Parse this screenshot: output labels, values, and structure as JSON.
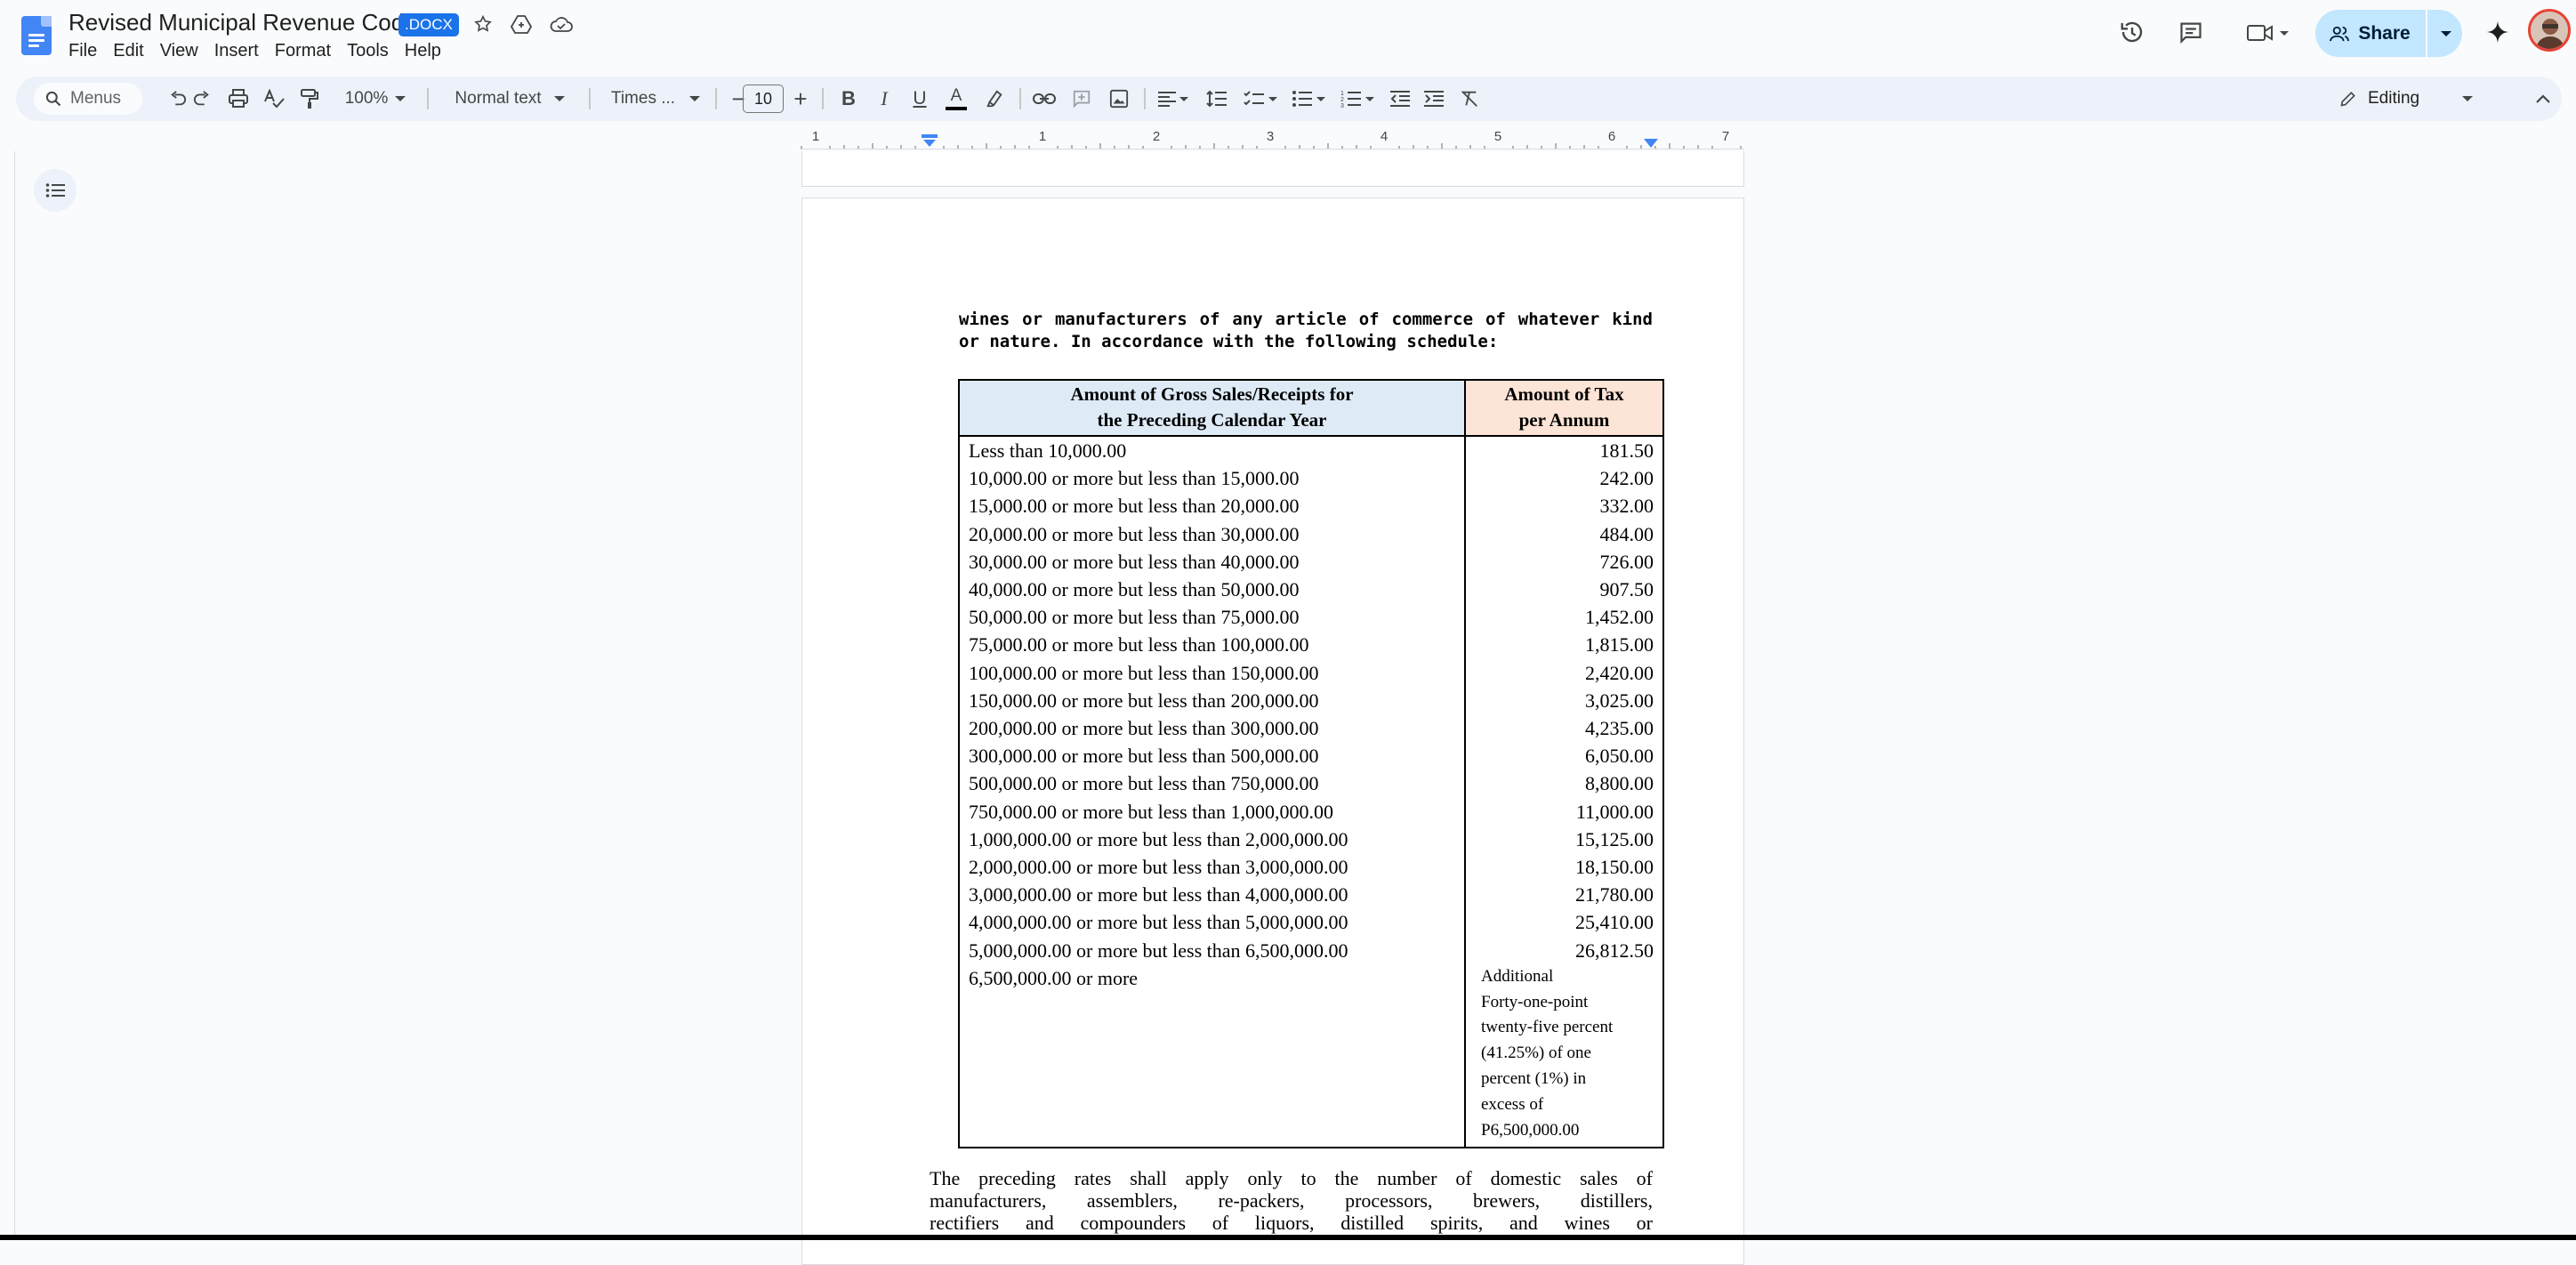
{
  "app": {
    "doc_title": "Revised Municipal Revenue Code",
    "file_badge": ".DOCX",
    "menu": [
      "File",
      "Edit",
      "View",
      "Insert",
      "Format",
      "Tools",
      "Help"
    ],
    "share_label": "Share"
  },
  "toolbar": {
    "menus_search": "Menus",
    "zoom": "100%",
    "style": "Normal text",
    "font": "Times ...",
    "font_size": "10",
    "mode": "Editing"
  },
  "ruler": {
    "labels": [
      "1",
      "1",
      "2",
      "3",
      "4",
      "5",
      "6",
      "7"
    ]
  },
  "document": {
    "intro_line1": "wines or manufacturers of any article of commerce of whatever kind",
    "intro_line2": "or nature.  In accordance with the following schedule:",
    "table": {
      "header_left": [
        "Amount of Gross Sales/Receipts for",
        "the Preceding Calendar Year"
      ],
      "header_right": [
        "Amount of Tax",
        "per Annum"
      ],
      "rows": [
        {
          "range": "Less than 10,000.00",
          "tax": "181.50"
        },
        {
          "range": "10,000.00 or more but less than 15,000.00",
          "tax": "242.00"
        },
        {
          "range": "15,000.00 or more but less than 20,000.00",
          "tax": "332.00"
        },
        {
          "range": "20,000.00 or more but less than 30,000.00",
          "tax": "484.00"
        },
        {
          "range": "30,000.00 or more but less than 40,000.00",
          "tax": "726.00"
        },
        {
          "range": "40,000.00 or more but less than 50,000.00",
          "tax": "907.50"
        },
        {
          "range": "50,000.00 or more but less than 75,000.00",
          "tax": "1,452.00"
        },
        {
          "range": "75,000.00 or more but less than 100,000.00",
          "tax": "1,815.00"
        },
        {
          "range": "100,000.00 or more but less than 150,000.00",
          "tax": "2,420.00"
        },
        {
          "range": "150,000.00 or more but less than 200,000.00",
          "tax": "3,025.00"
        },
        {
          "range": "200,000.00 or more but less than 300,000.00",
          "tax": "4,235.00"
        },
        {
          "range": "300,000.00 or more but less than 500,000.00",
          "tax": "6,050.00"
        },
        {
          "range": "500,000.00 or more but less than 750,000.00",
          "tax": "8,800.00"
        },
        {
          "range": "750,000.00 or more but less than 1,000,000.00",
          "tax": "11,000.00"
        },
        {
          "range": "1,000,000.00 or more but less than 2,000,000.00",
          "tax": "15,125.00"
        },
        {
          "range": "2,000,000.00 or more but less than 3,000,000.00",
          "tax": "18,150.00"
        },
        {
          "range": "3,000,000.00 or more but less than 4,000,000.00",
          "tax": "21,780.00"
        },
        {
          "range": "4,000,000.00 or more but less than 5,000,000.00",
          "tax": "25,410.00"
        },
        {
          "range": "5,000,000.00 or more but less than 6,500,000.00",
          "tax": "26,812.50"
        }
      ],
      "last_row_range": "6,500,000.00 or more",
      "last_row_tax_lines": [
        "Additional",
        "Forty-one-point",
        "twenty-five percent",
        "(41.25%) of one",
        "percent (1%) in",
        "excess of",
        "P6,500,000.00"
      ]
    },
    "after_lines": [
      "The  preceding  rates  shall  apply  only  to  the  number  of  domestic  sales  of",
      "manufacturers,   assemblers,   re-packers,   processors,   brewers,   distillers,",
      "rectifiers   and   compounders   of   liquors,   distilled   spirits,   and   wines   or"
    ]
  }
}
